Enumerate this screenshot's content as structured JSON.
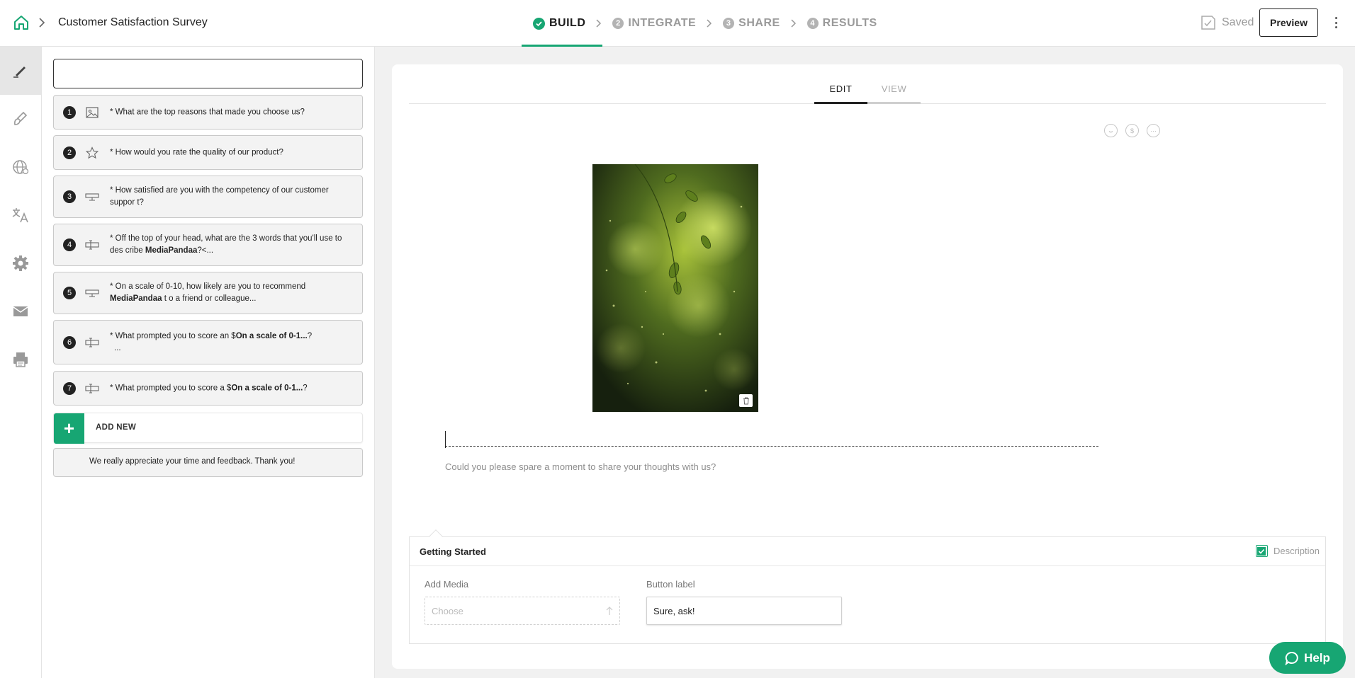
{
  "header": {
    "survey_title": "Customer Satisfaction Survey",
    "steps": [
      {
        "num": "",
        "label": "BUILD"
      },
      {
        "num": "2",
        "label": "INTEGRATE"
      },
      {
        "num": "3",
        "label": "SHARE"
      },
      {
        "num": "4",
        "label": "RESULTS"
      }
    ],
    "saved_label": "Saved",
    "preview_label": "Preview",
    "accent_color": "#17a673"
  },
  "rail": {
    "items": [
      "pen-icon",
      "brush-icon",
      "globe-icon",
      "translate-icon",
      "gear-icon",
      "mail-icon",
      "printer-icon"
    ]
  },
  "questions": {
    "search_placeholder": "",
    "items": [
      {
        "num": "1",
        "icon": "image-icon",
        "prefix": "* ",
        "text": "What are the top reasons that made you choose us?"
      },
      {
        "num": "2",
        "icon": "star-icon",
        "prefix": "* ",
        "text": "How would you rate the quality of our product?"
      },
      {
        "num": "3",
        "icon": "scale-icon",
        "prefix": "* ",
        "text": "How satisfied are you with the competency of our customer suppor t?"
      },
      {
        "num": "4",
        "icon": "text-input-icon",
        "prefix": "* ",
        "text_before": "Off the top of your head, what are the 3 words that you'll use to des cribe ",
        "bold": "MediaPandaa",
        "text_after": "?<..."
      },
      {
        "num": "5",
        "icon": "scale-icon",
        "prefix": "* ",
        "text_before": "On a scale of 0-10, how likely are you to recommend ",
        "bold": "MediaPandaa",
        "text_after": " t o a friend or colleague..."
      },
      {
        "num": "6",
        "icon": "text-input-icon",
        "prefix": "* ",
        "text_before": "What prompted you to score an $",
        "bold": "On a scale of 0-1...",
        "text_after": "?",
        "line2": "..."
      },
      {
        "num": "7",
        "icon": "text-input-icon",
        "prefix": "* ",
        "text_before": "What prompted you to score a $",
        "bold": "On a scale of 0-1...",
        "text_after": "?"
      }
    ],
    "add_new_label": "ADD NEW",
    "thanks_text": "We really appreciate your time and feedback. Thank you!"
  },
  "editor": {
    "tabs": [
      "EDIT",
      "VIEW"
    ],
    "title_value": "",
    "subtitle": "Could you please spare a moment to share your thoughts with us?",
    "image_alt": "green leaves bokeh"
  },
  "getting_started": {
    "title": "Getting Started",
    "description_label": "Description",
    "description_checked": true,
    "add_media_label": "Add Media",
    "choose_placeholder": "Choose",
    "button_label_label": "Button label",
    "button_label_value": "Sure, ask!"
  },
  "help": {
    "label": "Help"
  }
}
